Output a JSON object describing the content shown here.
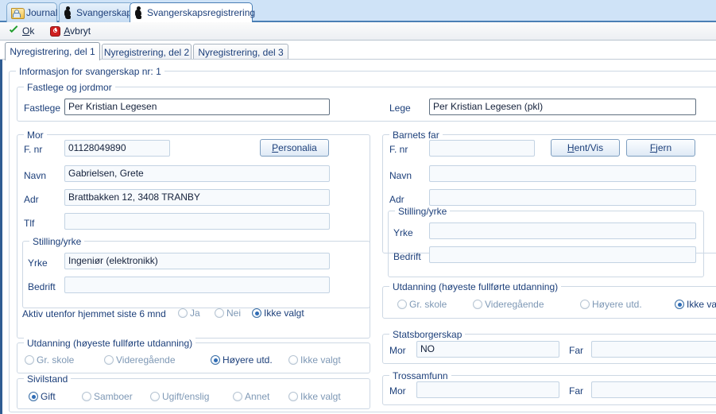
{
  "window": {
    "document_tabs": [
      {
        "label": "Journal",
        "icon": "journal-folder-icon",
        "active": false
      },
      {
        "label": "Svangerskap",
        "icon": "pregnancy-icon",
        "active": false
      },
      {
        "label": "Svangerskapsregistrering",
        "icon": "pregnancy-icon",
        "active": true
      }
    ]
  },
  "commandbar": {
    "ok": {
      "label": "Ok",
      "accel": "O",
      "icon": "green-check-icon"
    },
    "cancel": {
      "label": "Avbryt",
      "accel": "A",
      "icon": "red-cancel-icon"
    }
  },
  "page_tabs": [
    {
      "label": "Nyregistrering, del 1",
      "active": true
    },
    {
      "label": "Nyregistrering, del 2",
      "active": false
    },
    {
      "label": "Nyregistrering, del 3",
      "active": false
    }
  ],
  "form": {
    "outer_group_label": "Informasjon for svangerskap nr: 1",
    "doctor_group": {
      "legend": "Fastlege og jordmor",
      "fastlege_label": "Fastlege",
      "fastlege_value": "Per Kristian Legesen",
      "lege_label": "Lege",
      "lege_value": "Per Kristian Legesen (pkl)"
    },
    "mother": {
      "legend": "Mor",
      "fnr_label": "F. nr",
      "fnr_value": "01128049890",
      "personalia_button": "Personalia",
      "personalia_accel": "P",
      "navn_label": "Navn",
      "navn_value": "Gabrielsen, Grete",
      "adr_label": "Adr",
      "adr_value": "Brattbakken 12, 3408 TRANBY",
      "tlf_label": "Tlf",
      "tlf_value": "",
      "occupation": {
        "legend": "Stilling/yrke",
        "yrke_label": "Yrke",
        "yrke_value": "Ingeniør (elektronikk)",
        "bedrift_label": "Bedrift",
        "bedrift_value": ""
      },
      "active_question": {
        "label": "Aktiv utenfor hjemmet siste 6 mnd",
        "options": [
          {
            "label": "Ja",
            "selected": false
          },
          {
            "label": "Nei",
            "selected": false
          },
          {
            "label": "Ikke valgt",
            "selected": true
          }
        ]
      },
      "education": {
        "legend": "Utdanning (høyeste fullførte utdanning)",
        "options": [
          {
            "label": "Gr. skole",
            "selected": false
          },
          {
            "label": "Videregående",
            "selected": false
          },
          {
            "label": "Høyere utd.",
            "selected": true
          },
          {
            "label": "Ikke valgt",
            "selected": false
          }
        ]
      },
      "marital": {
        "legend": "Sivilstand",
        "options": [
          {
            "label": "Gift",
            "selected": true
          },
          {
            "label": "Samboer",
            "selected": false
          },
          {
            "label": "Ugift/enslig",
            "selected": false
          },
          {
            "label": "Annet",
            "selected": false
          },
          {
            "label": "Ikke valgt",
            "selected": false
          }
        ]
      }
    },
    "father": {
      "legend": "Barnets far",
      "fnr_label": "F. nr",
      "fnr_value": "",
      "fetch_button": "Hent/Vis",
      "fetch_accel": "H",
      "remove_button": "Fjern",
      "remove_accel": "F",
      "navn_label": "Navn",
      "navn_value": "",
      "adr_label": "Adr",
      "adr_value": "",
      "occupation": {
        "legend": "Stilling/yrke",
        "yrke_label": "Yrke",
        "yrke_value": "",
        "bedrift_label": "Bedrift",
        "bedrift_value": ""
      },
      "education": {
        "legend": "Utdanning (høyeste fullførte utdanning)",
        "options": [
          {
            "label": "Gr. skole",
            "selected": false
          },
          {
            "label": "Videregående",
            "selected": false
          },
          {
            "label": "Høyere utd.",
            "selected": false
          },
          {
            "label": "Ikke valgt",
            "selected": true
          }
        ]
      }
    },
    "citizenship": {
      "legend": "Statsborgerskap",
      "mor_label": "Mor",
      "mor_value": "NO",
      "far_label": "Far",
      "far_value": ""
    },
    "religion": {
      "legend": "Trossamfunn",
      "mor_label": "Mor",
      "mor_value": "",
      "far_label": "Far",
      "far_value": ""
    }
  },
  "colors": {
    "accent": "#2f5c92",
    "tabbar": "#cfe3f7",
    "label_text": "#1c3f7a",
    "ok_green": "#1f9d2c",
    "cancel_red": "#cf2020"
  }
}
